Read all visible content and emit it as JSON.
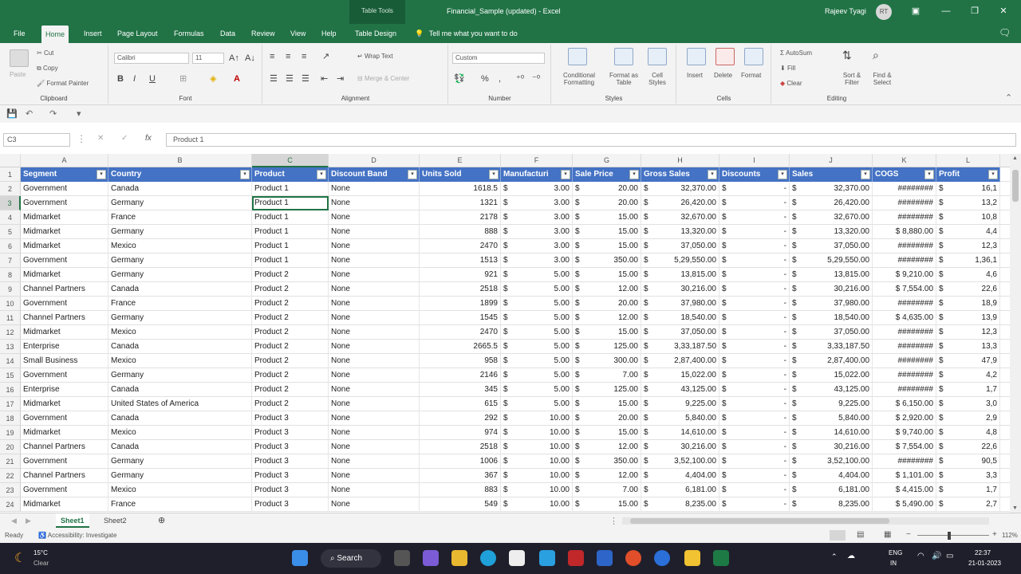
{
  "titlebar": {
    "context_label": "Table Tools",
    "document_title": "Financial_Sample (updated)  -  Excel",
    "user_name": "Rajeev Tyagi",
    "avatar_initials": "RT"
  },
  "menu": {
    "tabs": [
      "File",
      "Home",
      "Insert",
      "Page Layout",
      "Formulas",
      "Data",
      "Review",
      "View",
      "Help",
      "Table Design"
    ],
    "active_tab": "Home",
    "tell_me": "Tell me what you want to do"
  },
  "ribbon": {
    "clipboard": {
      "paste": "Paste",
      "cut": "Cut",
      "copy": "Copy",
      "format_painter": "Format Painter",
      "label": "Clipboard"
    },
    "font": {
      "name": "Calibri",
      "size": "11",
      "label": "Font"
    },
    "alignment": {
      "wrap_text": "Wrap Text",
      "merge_center": "Merge & Center",
      "label": "Alignment"
    },
    "number": {
      "format": "Custom",
      "label": "Number"
    },
    "styles": {
      "conditional": "Conditional Formatting",
      "format_table": "Format as Table",
      "cell_styles": "Cell Styles",
      "label": "Styles"
    },
    "cells": {
      "insert": "Insert",
      "delete": "Delete",
      "format": "Format",
      "label": "Cells"
    },
    "editing": {
      "autosum": "AutoSum",
      "fill": "Fill",
      "clear": "Clear",
      "sort_filter": "Sort & Filter",
      "find_select": "Find & Select",
      "label": "Editing"
    }
  },
  "formula_bar": {
    "name_box": "C3",
    "value": "Product 1"
  },
  "grid": {
    "columns": [
      "A",
      "B",
      "C",
      "D",
      "E",
      "F",
      "G",
      "H",
      "I",
      "J",
      "K",
      "L"
    ],
    "selected_column": "C",
    "selected_row": 3,
    "headers": [
      "Segment",
      "Country",
      "Product",
      "Discount Band",
      "Units Sold",
      "Manufacturi",
      "Sale Price",
      "Gross Sales",
      "Discounts",
      "Sales",
      "COGS",
      "Profit"
    ],
    "rows": [
      [
        "Government",
        "Canada",
        "Product 1",
        "None",
        "1618.5",
        "3.00",
        "20.00",
        "32,370.00",
        "-",
        "32,370.00",
        "########",
        "16,1"
      ],
      [
        "Government",
        "Germany",
        "Product 1",
        "None",
        "1321",
        "3.00",
        "20.00",
        "26,420.00",
        "-",
        "26,420.00",
        "########",
        "13,2"
      ],
      [
        "Midmarket",
        "France",
        "Product 1",
        "None",
        "2178",
        "3.00",
        "15.00",
        "32,670.00",
        "-",
        "32,670.00",
        "########",
        "10,8"
      ],
      [
        "Midmarket",
        "Germany",
        "Product 1",
        "None",
        "888",
        "3.00",
        "15.00",
        "13,320.00",
        "-",
        "13,320.00",
        "$ 8,880.00",
        "4,4"
      ],
      [
        "Midmarket",
        "Mexico",
        "Product 1",
        "None",
        "2470",
        "3.00",
        "15.00",
        "37,050.00",
        "-",
        "37,050.00",
        "########",
        "12,3"
      ],
      [
        "Government",
        "Germany",
        "Product 1",
        "None",
        "1513",
        "3.00",
        "350.00",
        "5,29,550.00",
        "-",
        "5,29,550.00",
        "########",
        "1,36,1"
      ],
      [
        "Midmarket",
        "Germany",
        "Product 2",
        "None",
        "921",
        "5.00",
        "15.00",
        "13,815.00",
        "-",
        "13,815.00",
        "$ 9,210.00",
        "4,6"
      ],
      [
        "Channel Partners",
        "Canada",
        "Product 2",
        "None",
        "2518",
        "5.00",
        "12.00",
        "30,216.00",
        "-",
        "30,216.00",
        "$ 7,554.00",
        "22,6"
      ],
      [
        "Government",
        "France",
        "Product 2",
        "None",
        "1899",
        "5.00",
        "20.00",
        "37,980.00",
        "-",
        "37,980.00",
        "########",
        "18,9"
      ],
      [
        "Channel Partners",
        "Germany",
        "Product 2",
        "None",
        "1545",
        "5.00",
        "12.00",
        "18,540.00",
        "-",
        "18,540.00",
        "$ 4,635.00",
        "13,9"
      ],
      [
        "Midmarket",
        "Mexico",
        "Product 2",
        "None",
        "2470",
        "5.00",
        "15.00",
        "37,050.00",
        "-",
        "37,050.00",
        "########",
        "12,3"
      ],
      [
        "Enterprise",
        "Canada",
        "Product 2",
        "None",
        "2665.5",
        "5.00",
        "125.00",
        "3,33,187.50",
        "-",
        "3,33,187.50",
        "########",
        "13,3"
      ],
      [
        "Small Business",
        "Mexico",
        "Product 2",
        "None",
        "958",
        "5.00",
        "300.00",
        "2,87,400.00",
        "-",
        "2,87,400.00",
        "########",
        "47,9"
      ],
      [
        "Government",
        "Germany",
        "Product 2",
        "None",
        "2146",
        "5.00",
        "7.00",
        "15,022.00",
        "-",
        "15,022.00",
        "########",
        "4,2"
      ],
      [
        "Enterprise",
        "Canada",
        "Product 2",
        "None",
        "345",
        "5.00",
        "125.00",
        "43,125.00",
        "-",
        "43,125.00",
        "########",
        "1,7"
      ],
      [
        "Midmarket",
        "United States of America",
        "Product 2",
        "None",
        "615",
        "5.00",
        "15.00",
        "9,225.00",
        "-",
        "9,225.00",
        "$ 6,150.00",
        "3,0"
      ],
      [
        "Government",
        "Canada",
        "Product 3",
        "None",
        "292",
        "10.00",
        "20.00",
        "5,840.00",
        "-",
        "5,840.00",
        "$ 2,920.00",
        "2,9"
      ],
      [
        "Midmarket",
        "Mexico",
        "Product 3",
        "None",
        "974",
        "10.00",
        "15.00",
        "14,610.00",
        "-",
        "14,610.00",
        "$ 9,740.00",
        "4,8"
      ],
      [
        "Channel Partners",
        "Canada",
        "Product 3",
        "None",
        "2518",
        "10.00",
        "12.00",
        "30,216.00",
        "-",
        "30,216.00",
        "$ 7,554.00",
        "22,6"
      ],
      [
        "Government",
        "Germany",
        "Product 3",
        "None",
        "1006",
        "10.00",
        "350.00",
        "3,52,100.00",
        "-",
        "3,52,100.00",
        "########",
        "90,5"
      ],
      [
        "Channel Partners",
        "Germany",
        "Product 3",
        "None",
        "367",
        "10.00",
        "12.00",
        "4,404.00",
        "-",
        "4,404.00",
        "$ 1,101.00",
        "3,3"
      ],
      [
        "Government",
        "Mexico",
        "Product 3",
        "None",
        "883",
        "10.00",
        "7.00",
        "6,181.00",
        "-",
        "6,181.00",
        "$ 4,415.00",
        "1,7"
      ],
      [
        "Midmarket",
        "France",
        "Product 3",
        "None",
        "549",
        "10.00",
        "15.00",
        "8,235.00",
        "-",
        "8,235.00",
        "$ 5,490.00",
        "2,7"
      ]
    ]
  },
  "sheets": {
    "tabs": [
      "Sheet1",
      "Sheet2"
    ],
    "active": "Sheet1"
  },
  "status": {
    "ready": "Ready",
    "accessibility": "Accessibility: Investigate",
    "zoom": "112%"
  },
  "taskbar": {
    "weather_temp": "15°C",
    "weather_desc": "Clear",
    "search": "Search",
    "lang": "ENG",
    "region": "IN",
    "time": "22:37",
    "date": "21-01-2023"
  },
  "colors": {
    "excel_green": "#217346",
    "table_header": "#4472c4"
  }
}
